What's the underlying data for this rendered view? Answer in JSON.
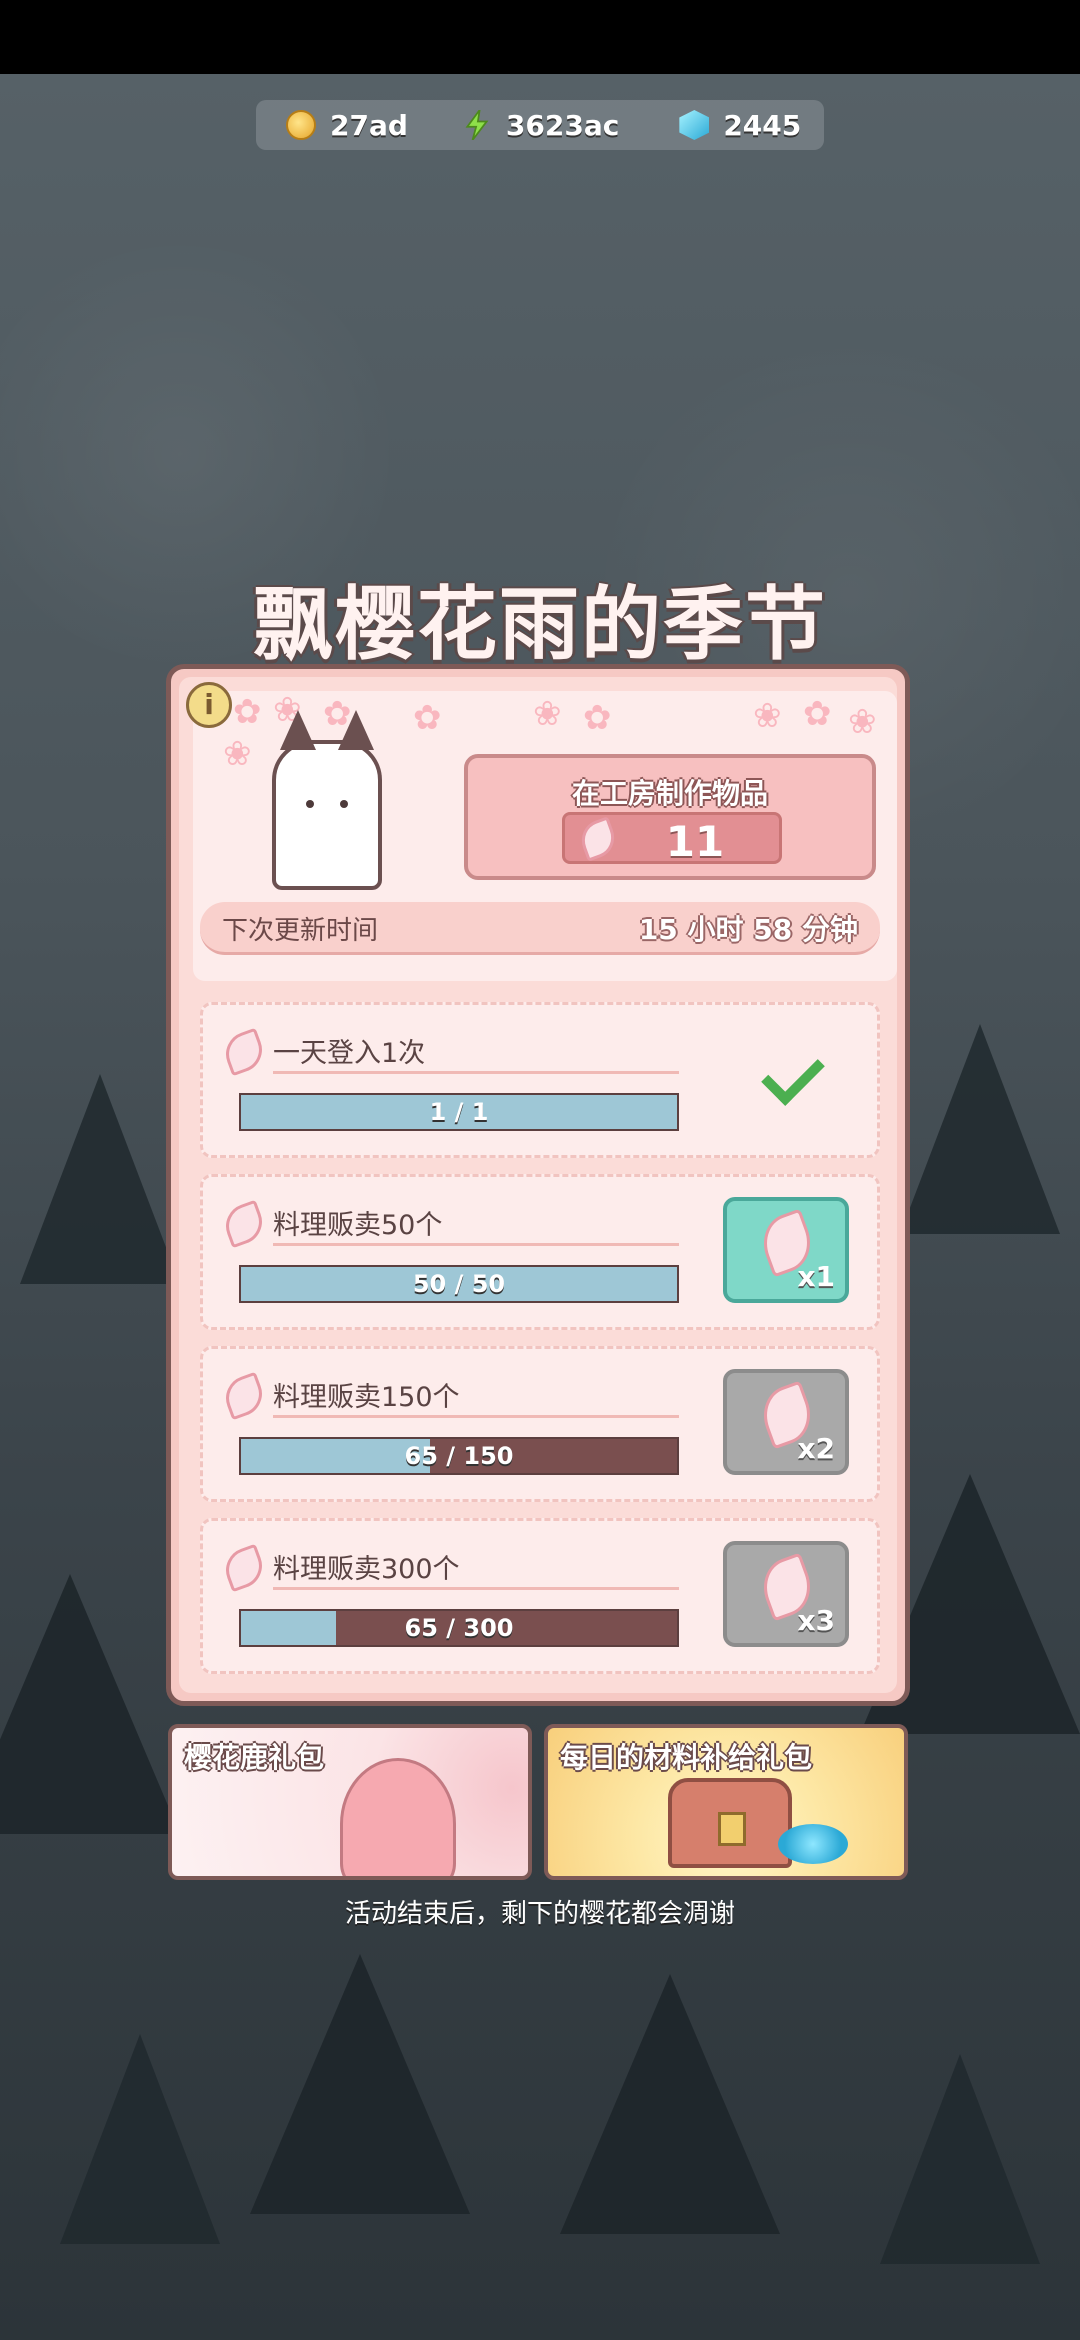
{
  "currencies": {
    "coins": "27ad",
    "energy": "3623ac",
    "gems": "2445"
  },
  "event": {
    "title": "飘樱花雨的季节",
    "workshop_label": "在工房制作物品",
    "petal_count": "11",
    "next_update_label": "下次更新时间",
    "next_update_time": "15 小时 58 分钟"
  },
  "tasks": [
    {
      "name": "一天登入1次",
      "progress_text": "1 / 1",
      "progress": 1.0,
      "status": "claimed"
    },
    {
      "name": "料理贩卖50个",
      "progress_text": "50 / 50",
      "progress": 1.0,
      "status": "claimable",
      "reward": "x1"
    },
    {
      "name": "料理贩卖150个",
      "progress_text": "65 / 150",
      "progress": 0.433,
      "status": "locked",
      "reward": "x2"
    },
    {
      "name": "料理贩卖300个",
      "progress_text": "65 / 300",
      "progress": 0.217,
      "status": "locked",
      "reward": "x3"
    }
  ],
  "packs": [
    {
      "title": "樱花鹿礼包"
    },
    {
      "title": "每日的材料补给礼包"
    }
  ],
  "footer_note": "活动结束后，剩下的樱花都会凋谢",
  "colors": {
    "panel": "#f6c9c4",
    "progress_fill": "#9ec7d6",
    "progress_empty": "#7a4f4f",
    "active_reward": "#7fd8c8",
    "locked_reward": "#a9a9a9"
  }
}
